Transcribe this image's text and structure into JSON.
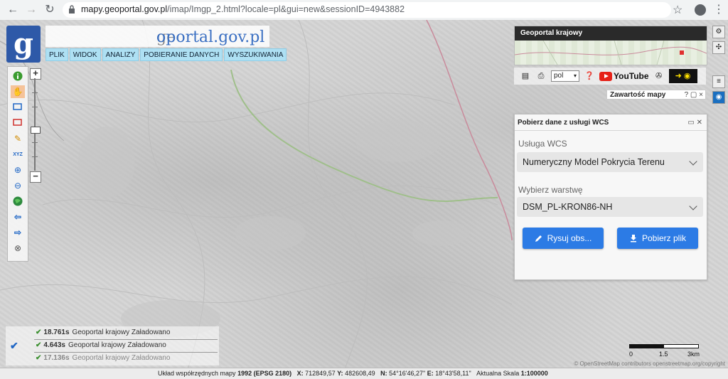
{
  "browser": {
    "url_host": "mapy.geoportal.gov.pl",
    "url_path": "/imap/Imgp_2.html?locale=pl&gui=new&sessionID=4943882"
  },
  "site": {
    "logo_letter": "g",
    "title_prefix": "ge",
    "title_rest": "oportal.gov.pl"
  },
  "menu": [
    "PLIK",
    "WIDOK",
    "ANALIZY",
    "POBIERANIE DANYCH",
    "WYSZUKIWANIA"
  ],
  "overview": {
    "title": "Geoportal krajowy"
  },
  "toolstrip": {
    "language": "pol",
    "youtube_label": "YouTube"
  },
  "content_panel": {
    "title": "Zawartość mapy",
    "controls": "? ▢ ×"
  },
  "wcs": {
    "title": "Pobierz dane z usługi WCS",
    "service_label": "Usługa WCS",
    "service_value": "Numeryczny Model Pokrycia Terenu",
    "layer_label": "Wybierz warstwę",
    "layer_value": "DSM_PL-KRON86-NH",
    "draw_button": "Rysuj obs...",
    "download_button": "Pobierz plik"
  },
  "load_status": [
    {
      "time": "18.761s",
      "name": "Geoportal krajowy",
      "state": "Załadowano"
    },
    {
      "time": "4.643s",
      "name": "Geoportal krajowy",
      "state": "Załadowano"
    },
    {
      "time": "17.136s",
      "name": "Geoportal krajowy",
      "state": "Załadowano"
    }
  ],
  "scale_bar": {
    "labels": [
      "0",
      "1.5",
      "3km"
    ]
  },
  "attribution": "© OpenStreetMap contributors openstreetmap.org/copyright",
  "bottom": {
    "crs_label": "Układ współrzędnych mapy",
    "crs_value": "1992 (EPSG 2180)",
    "x_label": "X:",
    "x_value": "712849,57",
    "y_label": "Y:",
    "y_value": "482608,49",
    "n_label": "N:",
    "n_value": "54°16'46,27\"",
    "e_label": "E:",
    "e_value": "18°43'58,11\"",
    "scale_label": "Aktualna Skala",
    "scale_value": "1:100000"
  },
  "colors": {
    "accent_blue": "#2c7be5",
    "menu_bg": "#aee0f3",
    "logo_bg": "#2e59a8",
    "route_pink": "#c98a9b",
    "route_green": "#9fbf8a"
  }
}
